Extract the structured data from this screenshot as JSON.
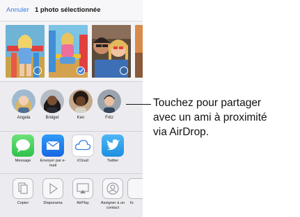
{
  "header": {
    "cancel_label": "Annuler",
    "title": "1 photo sélectionnée"
  },
  "photos": [
    {
      "name": "photo-1",
      "selected": false
    },
    {
      "name": "photo-2",
      "selected": true
    },
    {
      "name": "photo-3",
      "selected": false
    }
  ],
  "airdrop": {
    "contacts": [
      {
        "name": "Angela"
      },
      {
        "name": "Bridget"
      },
      {
        "name": "Ken"
      },
      {
        "name": "Fritz"
      }
    ]
  },
  "apps": [
    {
      "label": "Message",
      "icon": "message-icon",
      "color": "#4cd964"
    },
    {
      "label": "Envoyer par e-mail",
      "icon": "mail-icon",
      "color": "#1e7cf2"
    },
    {
      "label": "iCloud",
      "icon": "icloud-icon",
      "color": "#ffffff"
    },
    {
      "label": "Twitter",
      "icon": "twitter-icon",
      "color": "#1da1f2"
    }
  ],
  "actions": [
    {
      "label": "Copier",
      "icon": "copy-icon"
    },
    {
      "label": "Diaporama",
      "icon": "slideshow-icon"
    },
    {
      "label": "AirPlay",
      "icon": "airplay-icon"
    },
    {
      "label": "Assigner à un contact",
      "icon": "assign-contact-icon"
    },
    {
      "label": "fo",
      "icon": "more-action-icon"
    }
  ],
  "callout": {
    "line1": "Touchez pour partager",
    "line2": "avec un ami à proximité",
    "line3": "via AirDrop."
  },
  "colors": {
    "accent": "#3a7de0"
  }
}
